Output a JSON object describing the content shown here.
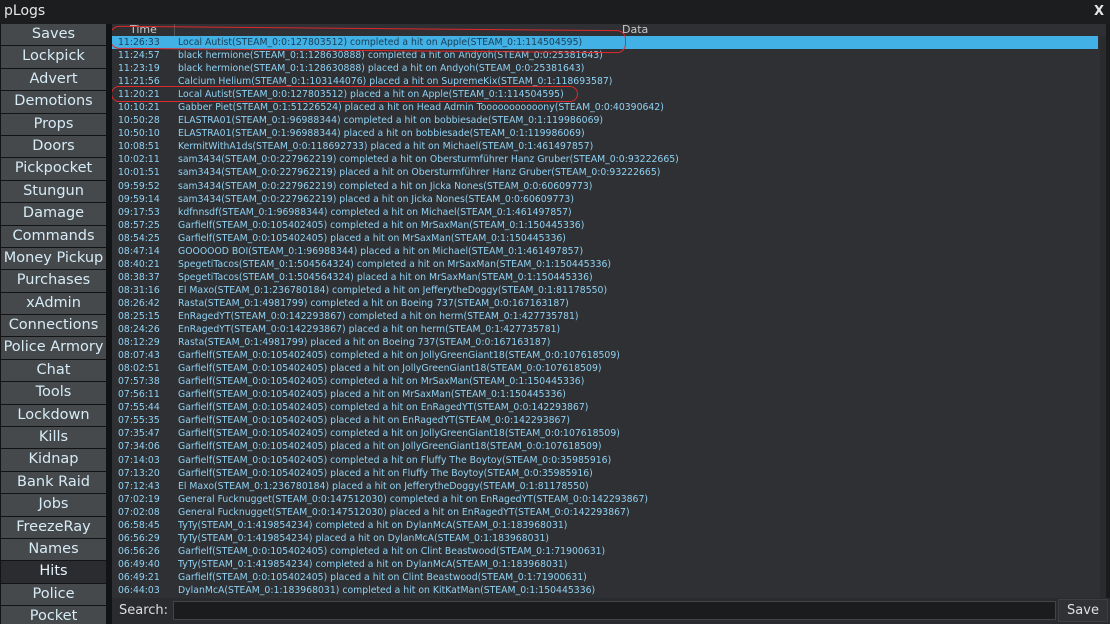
{
  "window": {
    "title": "pLogs",
    "close_label": "X"
  },
  "sidebar": {
    "items": [
      {
        "label": "Saves"
      },
      {
        "label": "Lockpick"
      },
      {
        "label": "Advert"
      },
      {
        "label": "Demotions"
      },
      {
        "label": "Props"
      },
      {
        "label": "Doors"
      },
      {
        "label": "Pickpocket"
      },
      {
        "label": "Stungun"
      },
      {
        "label": "Damage"
      },
      {
        "label": "Commands"
      },
      {
        "label": "Money Pickup"
      },
      {
        "label": "Purchases"
      },
      {
        "label": "xAdmin"
      },
      {
        "label": "Connections"
      },
      {
        "label": "Police Armory"
      },
      {
        "label": "Chat"
      },
      {
        "label": "Tools"
      },
      {
        "label": "Lockdown"
      },
      {
        "label": "Kills"
      },
      {
        "label": "Kidnap"
      },
      {
        "label": "Bank Raid"
      },
      {
        "label": "Jobs"
      },
      {
        "label": "FreezeRay"
      },
      {
        "label": "Names"
      },
      {
        "label": "Hits"
      },
      {
        "label": "Police"
      },
      {
        "label": "Pocket"
      }
    ],
    "active_label": "Hits"
  },
  "table": {
    "columns": {
      "time": "Time",
      "data": "Data"
    },
    "selected_index": 0,
    "rows": [
      {
        "time": "11:26:33",
        "data": "Local Autist(STEAM_0:0:127803512) completed a hit on Apple(STEAM_0:1:114504595)"
      },
      {
        "time": "11:24:57",
        "data": "black hermione(STEAM_0:1:128630888) completed a hit on Andyoh(STEAM_0:0:25381643)"
      },
      {
        "time": "11:23:19",
        "data": "black hermione(STEAM_0:1:128630888) placed a hit on Andyoh(STEAM_0:0:25381643)"
      },
      {
        "time": "11:21:56",
        "data": "Calcium Helium(STEAM_0:1:103144076) placed a hit on SupremeKix(STEAM_0:1:118693587)"
      },
      {
        "time": "11:20:21",
        "data": "Local Autist(STEAM_0:0:127803512) placed a hit on Apple(STEAM_0:1:114504595)"
      },
      {
        "time": "10:10:21",
        "data": "Gabber Piet(STEAM_0:1:51226524) placed a hit on Head Admin Tooooooooooony(STEAM_0:0:40390642)"
      },
      {
        "time": "10:50:28",
        "data": "ELASTRA01(STEAM_0:1:96988344) completed a hit on bobbiesade(STEAM_0:1:119986069)"
      },
      {
        "time": "10:50:10",
        "data": "ELASTRA01(STEAM_0:1:96988344) placed a hit on bobbiesade(STEAM_0:1:119986069)"
      },
      {
        "time": "10:08:51",
        "data": "KermitWithA1ds(STEAM_0:0:118692733) placed a hit on Michael(STEAM_0:1:461497857)"
      },
      {
        "time": "10:02:11",
        "data": "sam3434(STEAM_0:0:227962219) completed a hit on Obersturmführer Hanz Gruber(STEAM_0:0:93222665)"
      },
      {
        "time": "10:01:51",
        "data": "sam3434(STEAM_0:0:227962219) placed a hit on Obersturmführer Hanz Gruber(STEAM_0:0:93222665)"
      },
      {
        "time": "09:59:52",
        "data": "sam3434(STEAM_0:0:227962219) completed a hit on Jicka Nones(STEAM_0:0:60609773)"
      },
      {
        "time": "09:59:14",
        "data": "sam3434(STEAM_0:0:227962219) placed a hit on Jicka Nones(STEAM_0:0:60609773)"
      },
      {
        "time": "09:17:53",
        "data": "kdfnnsdf(STEAM_0:1:96988344) completed a hit on Michael(STEAM_0:1:461497857)"
      },
      {
        "time": "08:57:25",
        "data": "Garfielf(STEAM_0:0:105402405) completed a hit on MrSaxMan(STEAM_0:1:150445336)"
      },
      {
        "time": "08:54:25",
        "data": "Garfielf(STEAM_0:0:105402405) placed a hit on MrSaxMan(STEAM_0:1:150445336)"
      },
      {
        "time": "08:47:14",
        "data": "GOOOOOD BOI(STEAM_0:1:96988344) placed a hit on Michael(STEAM_0:1:461497857)"
      },
      {
        "time": "08:40:21",
        "data": "SpegetiTacos(STEAM_0:1:504564324) completed a hit on MrSaxMan(STEAM_0:1:150445336)"
      },
      {
        "time": "08:38:37",
        "data": "SpegetiTacos(STEAM_0:1:504564324) placed a hit on MrSaxMan(STEAM_0:1:150445336)"
      },
      {
        "time": "08:31:16",
        "data": "El Maxo(STEAM_0:1:236780184) completed a hit on JefferytheDoggy(STEAM_0:1:81178550)"
      },
      {
        "time": "08:26:42",
        "data": "Rasta(STEAM_0:1:4981799) completed a hit on Boeing 737(STEAM_0:0:167163187)"
      },
      {
        "time": "08:25:15",
        "data": "EnRagedYT(STEAM_0:0:142293867) completed a hit on herm(STEAM_0:1:427735781)"
      },
      {
        "time": "08:24:26",
        "data": "EnRagedYT(STEAM_0:0:142293867) placed a hit on herm(STEAM_0:1:427735781)"
      },
      {
        "time": "08:12:29",
        "data": "Rasta(STEAM_0:1:4981799) placed a hit on Boeing 737(STEAM_0:0:167163187)"
      },
      {
        "time": "08:07:43",
        "data": "Garfielf(STEAM_0:0:105402405) completed a hit on JollyGreenGiant18(STEAM_0:0:107618509)"
      },
      {
        "time": "08:02:51",
        "data": "Garfielf(STEAM_0:0:105402405) placed a hit on JollyGreenGiant18(STEAM_0:0:107618509)"
      },
      {
        "time": "07:57:38",
        "data": "Garfielf(STEAM_0:0:105402405) completed a hit on MrSaxMan(STEAM_0:1:150445336)"
      },
      {
        "time": "07:56:11",
        "data": "Garfielf(STEAM_0:0:105402405) placed a hit on MrSaxMan(STEAM_0:1:150445336)"
      },
      {
        "time": "07:55:44",
        "data": "Garfielf(STEAM_0:0:105402405) completed a hit on EnRagedYT(STEAM_0:0:142293867)"
      },
      {
        "time": "07:55:35",
        "data": "Garfielf(STEAM_0:0:105402405) placed a hit on EnRagedYT(STEAM_0:0:142293867)"
      },
      {
        "time": "07:35:47",
        "data": "Garfielf(STEAM_0:0:105402405) completed a hit on JollyGreenGiant18(STEAM_0:0:107618509)"
      },
      {
        "time": "07:34:06",
        "data": "Garfielf(STEAM_0:0:105402405) placed a hit on JollyGreenGiant18(STEAM_0:0:107618509)"
      },
      {
        "time": "07:14:03",
        "data": "Garfielf(STEAM_0:0:105402405) completed a hit on Fluffy The Boytoy(STEAM_0:0:35985916)"
      },
      {
        "time": "07:13:20",
        "data": "Garfielf(STEAM_0:0:105402405) placed a hit on Fluffy The Boytoy(STEAM_0:0:35985916)"
      },
      {
        "time": "07:12:43",
        "data": "El Maxo(STEAM_0:1:236780184) placed a hit on JefferytheDoggy(STEAM_0:1:81178550)"
      },
      {
        "time": "07:02:19",
        "data": "General Fucknugget(STEAM_0:0:147512030) completed a hit on EnRagedYT(STEAM_0:0:142293867)"
      },
      {
        "time": "07:02:08",
        "data": "General Fucknugget(STEAM_0:0:147512030) placed a hit on EnRagedYT(STEAM_0:0:142293867)"
      },
      {
        "time": "06:58:45",
        "data": "TyTy(STEAM_0:1:419854234) completed a hit on DylanMcA(STEAM_0:1:183968031)"
      },
      {
        "time": "06:56:29",
        "data": "TyTy(STEAM_0:1:419854234) placed a hit on DylanMcA(STEAM_0:1:183968031)"
      },
      {
        "time": "06:56:26",
        "data": "Garfielf(STEAM_0:0:105402405) completed a hit on Clint Beastwood(STEAM_0:1:71900631)"
      },
      {
        "time": "06:49:40",
        "data": "TyTy(STEAM_0:1:419854234) completed a hit on DylanMcA(STEAM_0:1:183968031)"
      },
      {
        "time": "06:49:21",
        "data": "Garfielf(STEAM_0:0:105402405) placed a hit on Clint Beastwood(STEAM_0:1:71900631)"
      },
      {
        "time": "06:44:03",
        "data": "DylanMcA(STEAM_0:1:183968031) completed a hit on KitKatMan(STEAM_0:1:150445336)"
      }
    ]
  },
  "search": {
    "label": "Search:",
    "value": "",
    "placeholder": ""
  },
  "save_button": {
    "label": "Save"
  },
  "colors": {
    "accent_selected": "#41b1e6",
    "row_text": "#8fd2f4",
    "annotation_red": "#e0292b",
    "sidebar_button": "#46494c"
  }
}
